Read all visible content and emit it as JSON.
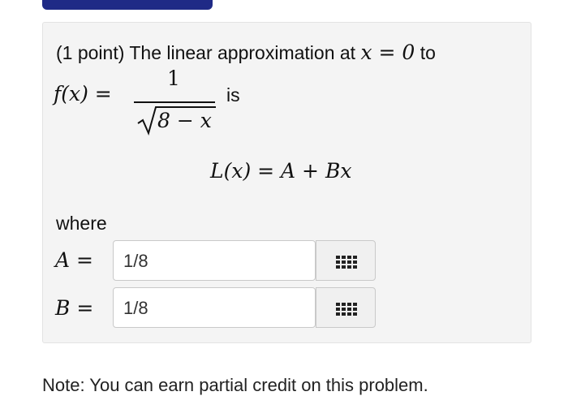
{
  "problem": {
    "intro_prefix": "(1 point) The linear approximation at",
    "intro_math": "x = 0",
    "intro_suffix": "to",
    "f_lhs": "f(x) =",
    "numerator": "1",
    "denominator": "8 − x",
    "is_text": "is",
    "equation": "L(x) = A + Bx",
    "where_text": "where"
  },
  "fields": [
    {
      "label": "A =",
      "value": "1/8",
      "keyboard_icon": "keyboard-grid-icon"
    },
    {
      "label": "B =",
      "value": "1/8",
      "keyboard_icon": "keyboard-grid-icon"
    }
  ],
  "note": "Note: You can earn partial credit on this problem."
}
